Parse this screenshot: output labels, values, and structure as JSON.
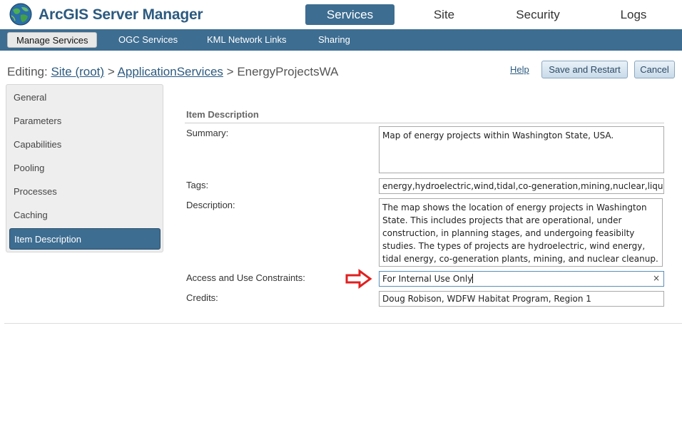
{
  "app": {
    "title": "ArcGIS Server Manager"
  },
  "topnav": {
    "services": "Services",
    "site": "Site",
    "security": "Security",
    "logs": "Logs"
  },
  "subnav": {
    "manage": "Manage Services",
    "ogc": "OGC Services",
    "kml": "KML Network Links",
    "sharing": "Sharing"
  },
  "editing": {
    "prefix": "Editing:",
    "site": "Site (root)",
    "sep1": ">",
    "folder": "ApplicationServices",
    "sep2": ">",
    "service": "EnergyProjectsWA"
  },
  "actions": {
    "help": "Help",
    "save": "Save and Restart",
    "cancel": "Cancel"
  },
  "sidebar": {
    "items": [
      {
        "label": "General"
      },
      {
        "label": "Parameters"
      },
      {
        "label": "Capabilities"
      },
      {
        "label": "Pooling"
      },
      {
        "label": "Processes"
      },
      {
        "label": "Caching"
      },
      {
        "label": "Item Description"
      }
    ]
  },
  "form": {
    "section_title": "Item Description",
    "summary": {
      "label": "Summary:",
      "value": "Map of energy projects within Washington State, USA."
    },
    "tags": {
      "label": "Tags:",
      "value": "energy,hydroelectric,wind,tidal,co-generation,mining,nuclear,liqu"
    },
    "description": {
      "label": "Description:",
      "value": "The map shows the location of energy projects in Washington State.  This includes projects that are operational, under construction, in planning stages, and undergoing feasibilty studies.  The types of projects are hydroelectric, wind energy, tidal energy, co-generation plants, mining, and nuclear cleanup."
    },
    "access": {
      "label": "Access and Use Constraints:",
      "value": "For Internal Use Only",
      "clear": "×"
    },
    "credits": {
      "label": "Credits:",
      "value": "Doug Robison, WDFW Habitat Program, Region 1"
    }
  },
  "colors": {
    "brand": "#3d6d91",
    "annotation_arrow": "#e02020"
  },
  "icons": {
    "logo": "globe-icon",
    "arrow": "red-arrow-icon",
    "clear": "clear-icon"
  }
}
